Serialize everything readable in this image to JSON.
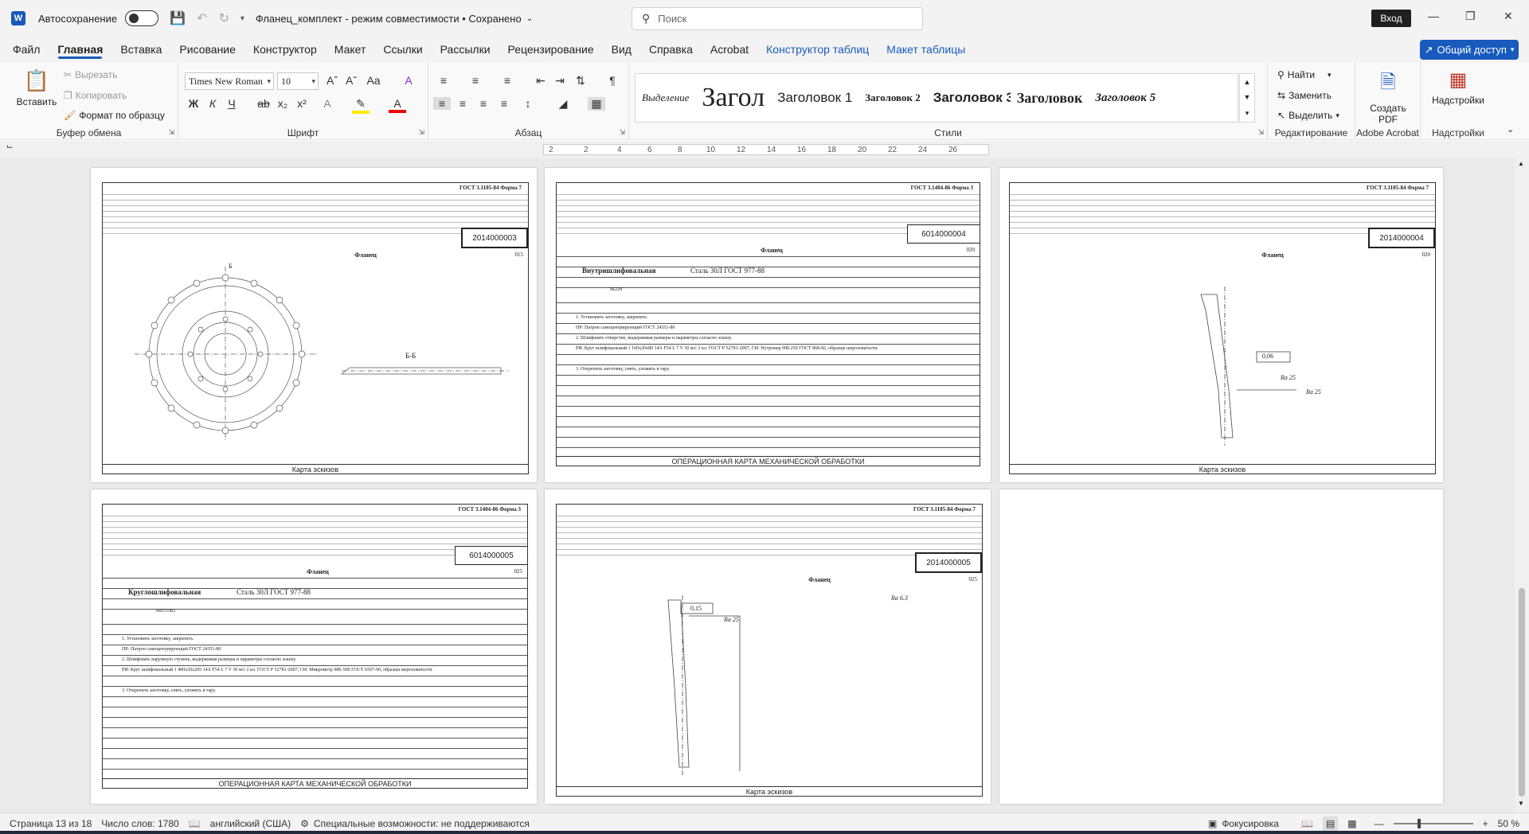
{
  "app": {
    "autosave_label": "Автосохранение",
    "doc_title": "Фланец_комплект  -  режим совместимости • Сохранено",
    "search_placeholder": "Поиск",
    "signin_label": "Вход"
  },
  "menu": {
    "tabs": [
      "Файл",
      "Главная",
      "Вставка",
      "Рисование",
      "Конструктор",
      "Макет",
      "Ссылки",
      "Рассылки",
      "Рецензирование",
      "Вид",
      "Справка",
      "Acrobat",
      "Конструктор таблиц",
      "Макет таблицы"
    ],
    "share_label": "Общий доступ"
  },
  "ribbon": {
    "clipboard": {
      "paste": "Вставить",
      "cut": "Вырезать",
      "copy": "Копировать",
      "format_painter": "Формат по образцу",
      "label": "Буфер обмена"
    },
    "font": {
      "name": "Times New Roman",
      "size": "10",
      "label": "Шрифт",
      "bold": "Ж",
      "italic": "К",
      "underline": "Ч"
    },
    "paragraph": {
      "label": "Абзац"
    },
    "styles": {
      "label": "Стили",
      "items": [
        "Выделение",
        "Загол",
        "Заголовок 1",
        "Заголовок 2",
        "Заголовок 3",
        "Заголовок",
        "Заголовок 5"
      ]
    },
    "editing": {
      "find": "Найти",
      "replace": "Заменить",
      "select": "Выделить",
      "label": "Редактирование"
    },
    "acrobat": {
      "create_pdf": "Создать PDF",
      "label": "Adobe Acrobat"
    },
    "addins": {
      "button": "Надстройки",
      "label": "Надстройки"
    }
  },
  "ruler": {
    "ticks": [
      "2",
      "2",
      "4",
      "6",
      "8",
      "10",
      "12",
      "14",
      "16",
      "18",
      "20",
      "22",
      "24",
      "26"
    ]
  },
  "sheets": [
    {
      "gost": "ГОСТ 3.1105-84     Форма 7",
      "doc_no": "2014000003",
      "part": "Фланец",
      "footer": "Карта эскизов",
      "sheet_no": "015",
      "section": "Б-Б",
      "section_mark": "Б"
    },
    {
      "gost": "ГОСТ 3.1404-86     Форма 3",
      "doc_no": "6014000004",
      "part": "Фланец",
      "footer": "ОПЕРАЦИОННАЯ КАРТА МЕХАНИЧЕСКОЙ ОБРАБОТКИ",
      "operation": "Внутришлифовальная",
      "material": "Сталь 30Л ГОСТ 977-88",
      "machine": "3К228",
      "sheet_no": "020",
      "lines": [
        "1. Установить заготовку, закрепить.",
        "ПР: Патрон самоцентрирующий ГОСТ 24351-80",
        "2. Шлифовать отверстие, выдерживая размеры и параметры согласно эскизу.",
        "РИ: Круг шлифовальный 1 160х20х80 14А F54 L 7 V 30 м/с 2 кл. ГОСТ Р 52781-2007; СИ: Нутромер НИ-250 ГОСТ 868-82, образцы шероховатости.",
        "",
        "3. Открепить заготовку, снять, уложить в тару."
      ]
    },
    {
      "gost": "ГОСТ 3.1105-84     Форма 7",
      "doc_no": "2014000004",
      "part": "Фланец",
      "footer": "Карта эскизов",
      "sheet_no": "020",
      "roughness_1": "Ra 25",
      "roughness_2": "Ra 25",
      "tol": "0,06"
    },
    {
      "gost": "ГОСТ 3.1404-86     Форма 3",
      "doc_no": "6014000005",
      "part": "Фланец",
      "footer": "ОПЕРАЦИОННАЯ КАРТА МЕХАНИЧЕСКОЙ ОБРАБОТКИ",
      "operation": "Круглошлифовальная",
      "material": "Сталь 30Л ГОСТ 977-88",
      "machine": "3М151Ф2",
      "sheet_no": "025",
      "lines": [
        "1. Установить заготовку, закрепить.",
        "ПР: Патрон самоцентрирующий ГОСТ 24351-80",
        "2. Шлифовать наружную ступень, выдерживая размеры и параметры согласно эскизу.",
        "РИ: Круг шлифовальный 1 400х20х205 14А F54 L 7 V 30 м/с 2 кл. ГОСТ Р 52781-2007; СИ: Микрометр МК-500 ГОСТ 6507-90, образцы шероховатости.",
        "",
        "3. Открепить заготовку, снять, уложить в тару."
      ]
    },
    {
      "gost": "ГОСТ 3.1105-84     Форма 7",
      "doc_no": "2014000005",
      "part": "Фланец",
      "footer": "Карта эскизов",
      "sheet_no": "025",
      "roughness_top": "Ra 6.3",
      "roughness_1": "Ra 25",
      "tol": "0,15"
    }
  ],
  "status": {
    "page": "Страница 13 из 18",
    "words": "Число слов: 1780",
    "lang": "английский (США)",
    "accessibility": "Специальные возможности: не поддерживаются",
    "focus": "Фокусировка",
    "zoom": "50 %"
  }
}
